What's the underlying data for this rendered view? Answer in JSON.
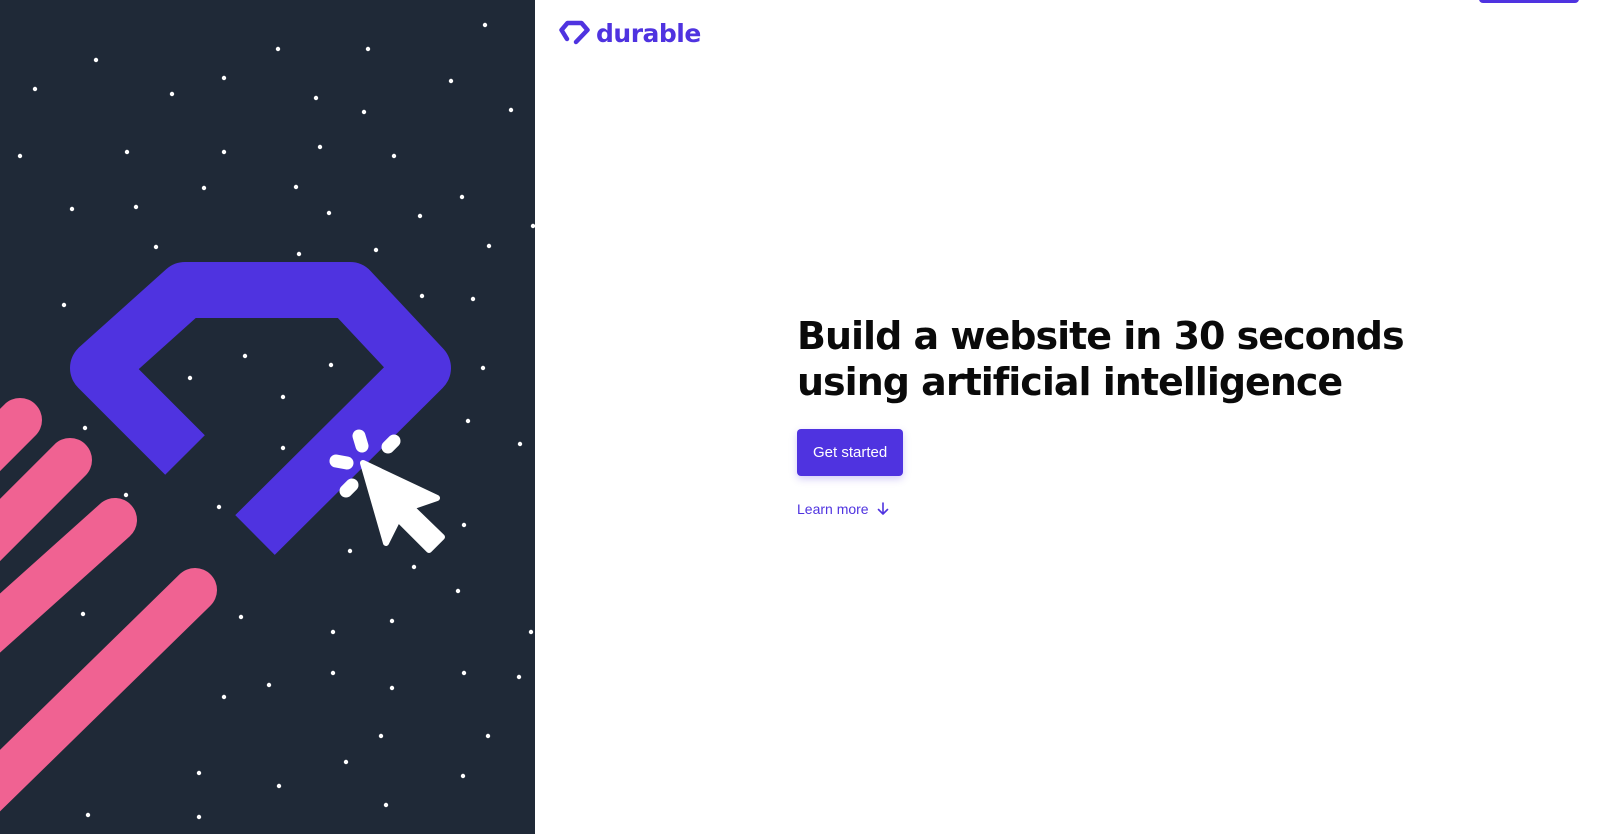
{
  "brand": {
    "name": "durable",
    "accent_color": "#4f33e0",
    "illustration_pink": "#f06292",
    "panel_color": "#1f2937"
  },
  "hero": {
    "title_line1": "Build a website in 30 seconds",
    "title_line2": "using artificial intelligence",
    "cta_label": "Get started",
    "learn_more_label": "Learn more",
    "learn_more_icon": "arrow-down-icon"
  },
  "illustration": {
    "icons": [
      "diamond-icon",
      "cursor-click-icon"
    ]
  }
}
